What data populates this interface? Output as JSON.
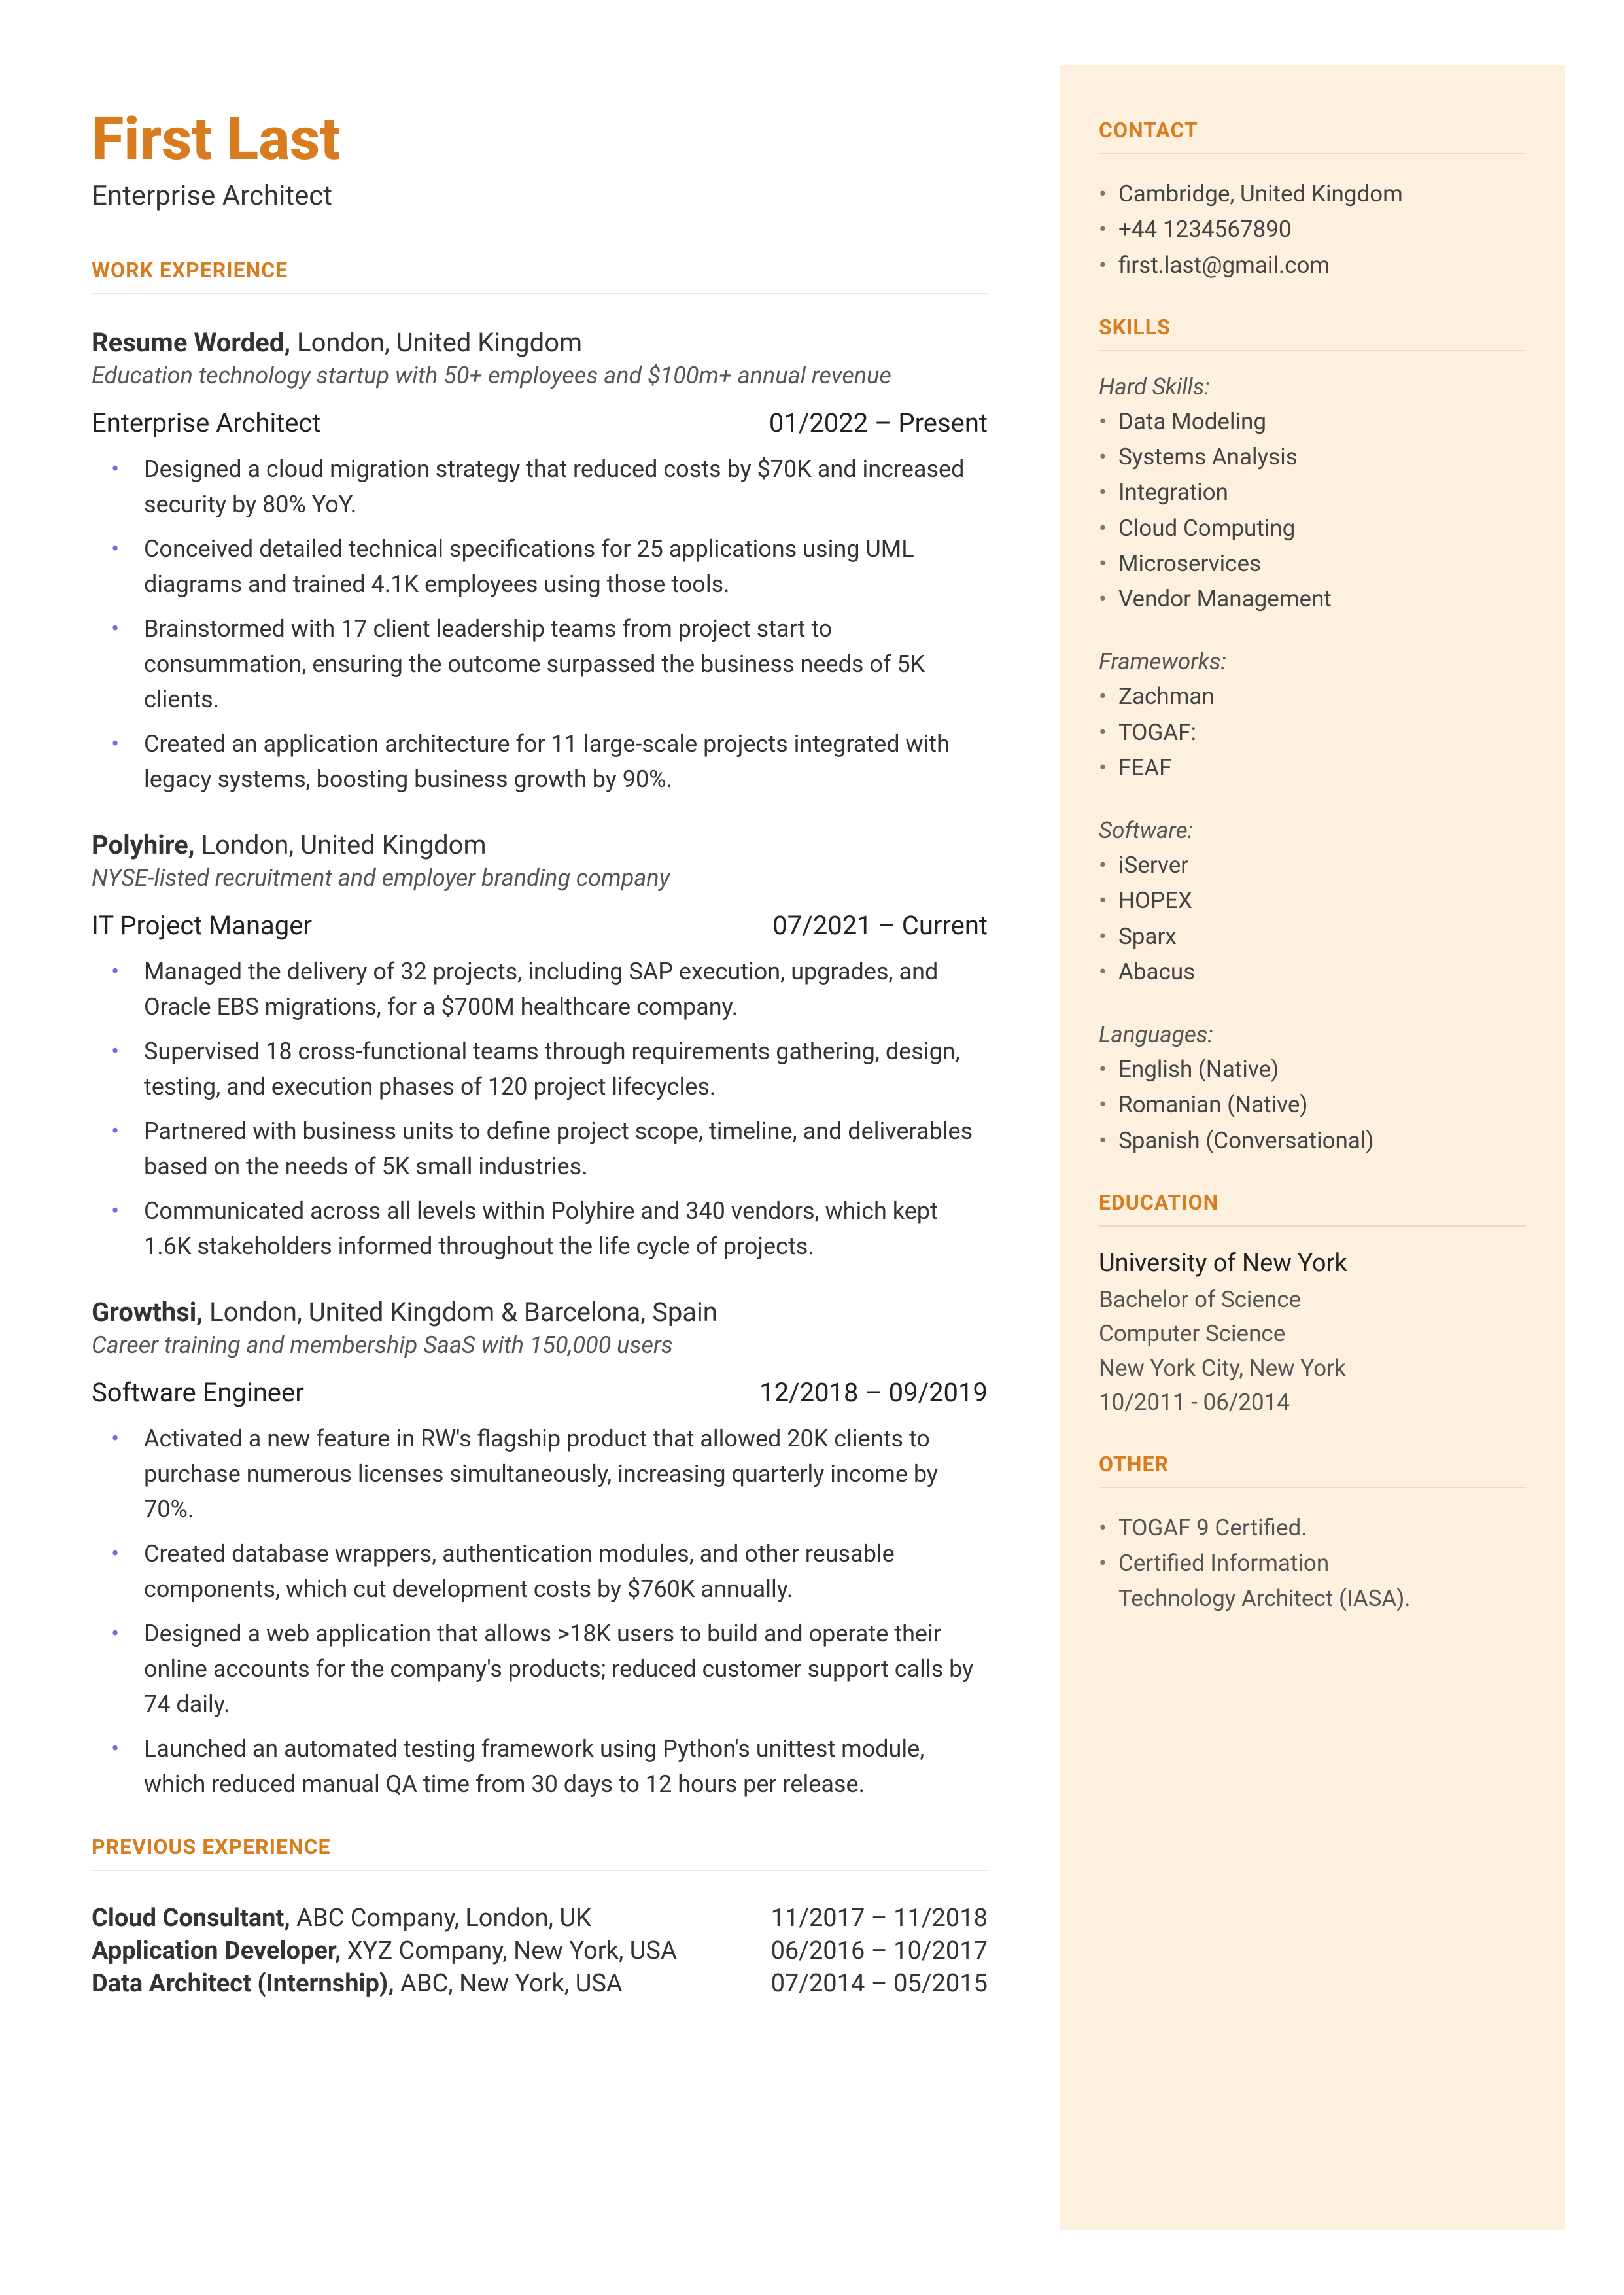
{
  "name": "First Last",
  "title": "Enterprise Architect",
  "sections": {
    "work": "WORK EXPERIENCE",
    "prev": "PREVIOUS EXPERIENCE",
    "contact": "CONTACT",
    "skills": "SKILLS",
    "education": "EDUCATION",
    "other": "OTHER"
  },
  "jobs": [
    {
      "company": "Resume Worded,",
      "location": " London, United Kingdom",
      "desc": "Education technology startup with 50+ employees and $100m+ annual revenue",
      "role": "Enterprise Architect",
      "dates": "01/2022 – Present",
      "bullets": [
        "Designed a cloud migration strategy that reduced costs by $70K and increased security by 80% YoY.",
        "Conceived detailed technical specifications for 25 applications using UML diagrams and trained 4.1K employees using those tools.",
        "Brainstormed with 17 client leadership teams from project start to consummation, ensuring the outcome surpassed the business needs of 5K clients.",
        "Created an application architecture for 11 large-scale projects integrated with legacy systems, boosting business growth by 90%."
      ]
    },
    {
      "company": "Polyhire,",
      "location": " London, United Kingdom",
      "desc": "NYSE-listed recruitment and employer branding company",
      "role": "IT Project Manager",
      "dates": "07/2021 – Current",
      "bullets": [
        "Managed the delivery of 32 projects, including SAP execution, upgrades, and Oracle EBS migrations, for a $700M healthcare company.",
        "Supervised 18 cross-functional teams through requirements gathering, design, testing, and execution phases of 120 project lifecycles.",
        "Partnered with business units to define project scope, timeline, and deliverables based on the needs of 5K small industries.",
        "Communicated across all levels within Polyhire and 340 vendors, which kept 1.6K stakeholders informed throughout the life cycle of projects."
      ]
    },
    {
      "company": "Growthsi,",
      "location": " London, United Kingdom & Barcelona, Spain",
      "desc": "Career training and membership SaaS with 150,000 users",
      "role": "Software Engineer",
      "dates": "12/2018 – 09/2019",
      "bullets": [
        "Activated a new feature in RW's flagship product that allowed 20K clients to purchase numerous licenses simultaneously, increasing quarterly income by 70%.",
        "Created database wrappers, authentication modules, and other reusable components, which cut development costs by $760K annually.",
        "Designed a web application that allows >18K users to build and operate their online accounts for the company's products; reduced customer support calls by 74 daily.",
        "Launched an automated testing framework using Python's unittest module, which reduced manual QA time from 30 days to 12 hours per release."
      ]
    }
  ],
  "previous": [
    {
      "role": "Cloud Consultant,",
      "rest": " ABC Company, London, UK",
      "dates": "11/2017 – 11/2018"
    },
    {
      "role": "Application Developer,",
      "rest": " XYZ Company, New York, USA",
      "dates": "06/2016 – 10/2017"
    },
    {
      "role": "Data Architect (Internship),",
      "rest": " ABC, New York, USA",
      "dates": "07/2014 – 05/2015"
    }
  ],
  "contact": [
    "Cambridge, United Kingdom",
    "+44 1234567890",
    "first.last@gmail.com"
  ],
  "skills": {
    "hard_label": "Hard Skills:",
    "hard": [
      "Data Modeling",
      "Systems Analysis",
      "Integration",
      "Cloud Computing",
      "Microservices",
      "Vendor Management"
    ],
    "frameworks_label": "Frameworks:",
    "frameworks": [
      "Zachman",
      "TOGAF:",
      "FEAF"
    ],
    "software_label": "Software:",
    "software": [
      "iServer",
      "HOPEX",
      "Sparx",
      "Abacus"
    ],
    "languages_label": "Languages:",
    "languages": [
      "English (Native)",
      "Romanian (Native)",
      "Spanish (Conversational)"
    ]
  },
  "education": {
    "school": "University of New York",
    "degree": "Bachelor of Science",
    "field": "Computer Science",
    "loc": "New York City, New York",
    "dates": "10/2011 - 06/2014"
  },
  "other": [
    "TOGAF 9 Certified.",
    "Certified Information",
    "Technology Architect (IASA)."
  ]
}
